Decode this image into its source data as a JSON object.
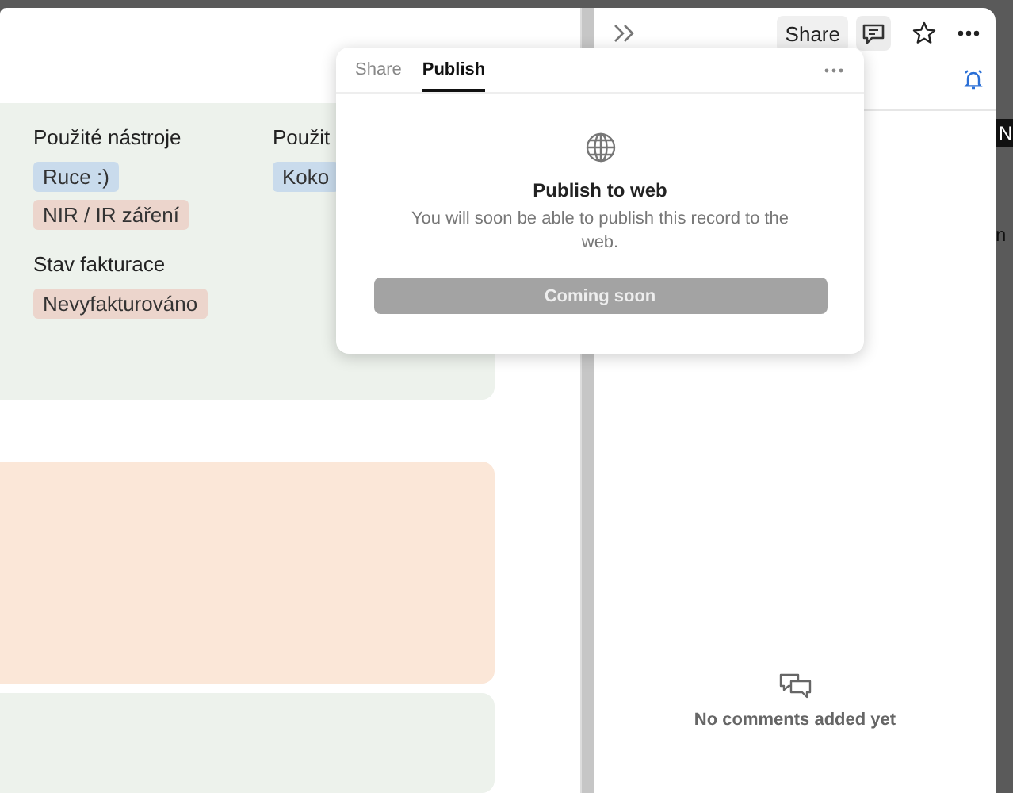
{
  "fields": [
    {
      "label": "Použité nástroje",
      "tags": [
        {
          "text": "Ruce :)",
          "color": "#c9dbec"
        },
        {
          "text": "NIR / IR záření",
          "color": "#ecd5cc"
        }
      ]
    },
    {
      "label": "Použit",
      "tags": [
        {
          "text": "Koko",
          "color": "#c9dbec"
        }
      ]
    },
    {
      "label": "Stav fakturace",
      "tags": [
        {
          "text": "Nevyfakturováno",
          "color": "#ecd5cc"
        }
      ]
    }
  ],
  "toolbar": {
    "share": "Share"
  },
  "popover": {
    "tabs": [
      {
        "label": "Share",
        "selected": false
      },
      {
        "label": "Publish",
        "selected": true
      }
    ],
    "title": "Publish to web",
    "description": "You will soon be able to publish this record to the web.",
    "button": {
      "label": "Coming soon",
      "disabled": true
    }
  },
  "comments": {
    "empty": "No comments added yet"
  },
  "edge": {
    "badge": "N",
    "text": "n"
  }
}
